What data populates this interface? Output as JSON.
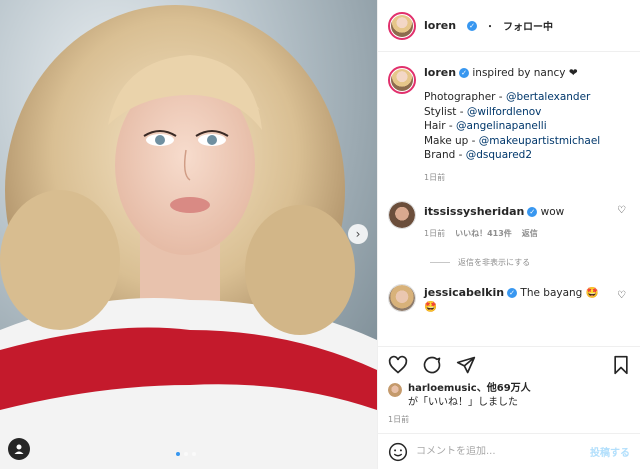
{
  "header": {
    "username": "loren",
    "separator": "・",
    "follow_label": "フォロー中"
  },
  "caption": {
    "username": "loren",
    "first_line": "inspired by nancy ❤",
    "credits": [
      {
        "role": "Photographer - ",
        "handle": "@bertalexander"
      },
      {
        "role": "Stylist - ",
        "handle": "@wilfordlenov"
      },
      {
        "role": "Hair - ",
        "handle": "@angelinapanelli"
      },
      {
        "role": "Make up - ",
        "handle": "@makeupartistmichael"
      },
      {
        "role": "Brand - ",
        "handle": "@dsquared2"
      }
    ],
    "time": "1日前"
  },
  "comments": [
    {
      "username": "itssissysheridan",
      "text": "wow",
      "time": "1日前",
      "likes": "いいね！413件",
      "reply": "返信"
    },
    {
      "username": "jessicabelkin",
      "text": "The bayang 🤩",
      "text2": "🤩"
    }
  ],
  "hide_replies": "返信を非表示にする",
  "likes": {
    "user": "harloemusic",
    "suffix": "、他69万人",
    "line2": "が「いいね！」しました"
  },
  "post_time": "1日前",
  "add_comment": {
    "placeholder": "コメントを追加...",
    "post_label": "投稿する"
  },
  "carousel": {
    "count": 3,
    "active": 0
  },
  "colors": {
    "verified": "#3897f0",
    "link": "#00376b",
    "muted": "#8e8e8e",
    "post_disabled": "#b2dffc"
  }
}
